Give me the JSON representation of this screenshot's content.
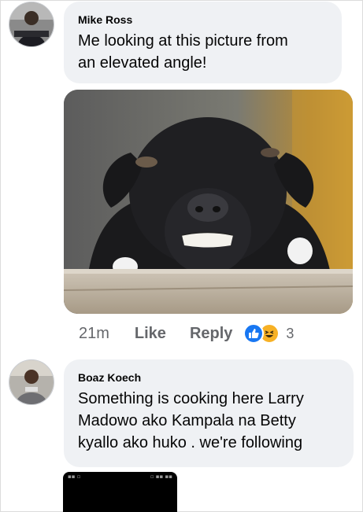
{
  "comments": [
    {
      "author": "Mike Ross",
      "lines": [
        "Me looking at this picture from",
        "an elevated angle!"
      ]
    },
    {
      "author": "Boaz Koech",
      "lines": [
        "Something is cooking here Larry",
        "Madowo ako Kampala na Betty",
        "kyallo ako huko . we're following"
      ]
    }
  ],
  "actions": {
    "time": "21m",
    "like_label": "Like",
    "reply_label": "Reply",
    "reaction_icons": [
      "like-icon",
      "haha-icon"
    ],
    "reaction_count": "3"
  },
  "colors": {
    "bubble": "#eff1f4",
    "meta_text": "#65676b",
    "like_blue": "#1877f2",
    "haha_yellow": "#f7b125"
  }
}
